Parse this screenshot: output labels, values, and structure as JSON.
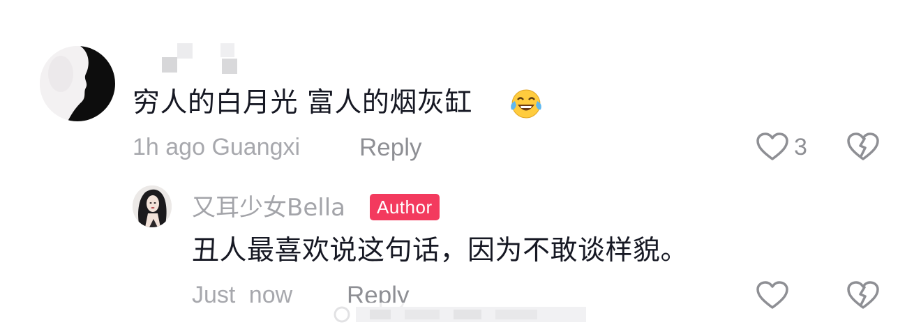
{
  "comment": {
    "text": "穷人的白月光 富人的烟灰缸",
    "emoji_icon": "tears-of-joy-emoji-icon",
    "time_location": "1h ago Guangxi",
    "reply_label": "Reply",
    "like_count": "3"
  },
  "reply": {
    "author_name": "又耳少女Bella",
    "author_badge": "Author",
    "text": "丑人最喜欢说这句话，因为不敢谈样貌。",
    "time": "Just now",
    "reply_label": "Reply"
  },
  "colors": {
    "badge": "#f33a5e",
    "meta_text": "#a7a8ad",
    "main_text": "#161823"
  }
}
